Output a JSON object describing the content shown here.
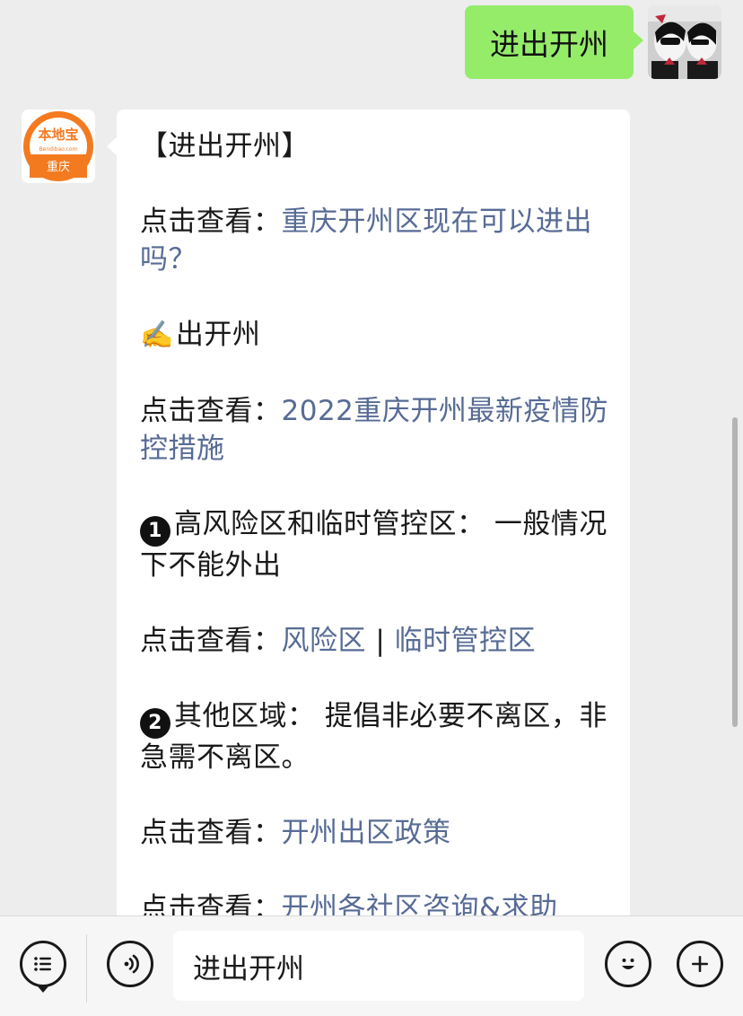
{
  "outgoing": {
    "text": "进出开州"
  },
  "incoming": {
    "sender_logo": {
      "brand": "本地宝",
      "domain": "Bendibao.com",
      "city": "重庆",
      "color": "#f47a20"
    },
    "title": "【进出开州】",
    "p1": {
      "prefix": "点击查看：",
      "link": "重庆开州区现在可以进出吗？"
    },
    "section": {
      "emoji": "✍️",
      "text": "出开州"
    },
    "p2": {
      "prefix": "点击查看：",
      "link": "2022重庆开州最新疫情防控措施"
    },
    "item1": {
      "marker": "1",
      "text": "高风险区和临时管控区： 一般情况下不能外出"
    },
    "p3": {
      "prefix": "点击查看：",
      "link1": "风险区",
      "sep": " | ",
      "link2": "临时管控区"
    },
    "item2": {
      "marker": "2",
      "text": "其他区域： 提倡非必要不离区，非急需不离区。"
    },
    "p4": {
      "prefix": "点击查看：",
      "link": "开州出区政策"
    },
    "p5": {
      "prefix": "点击查看：",
      "link": "开州各社区咨询&求助"
    }
  },
  "input_bar": {
    "text": "进出开州"
  },
  "icons": {
    "menu": "list-menu-icon",
    "voice": "voice-icon",
    "emoji": "emoji-icon",
    "plus": "plus-icon"
  },
  "colors": {
    "outgoing_bubble": "#95ec69",
    "link": "#576b95",
    "background": "#ededed"
  }
}
